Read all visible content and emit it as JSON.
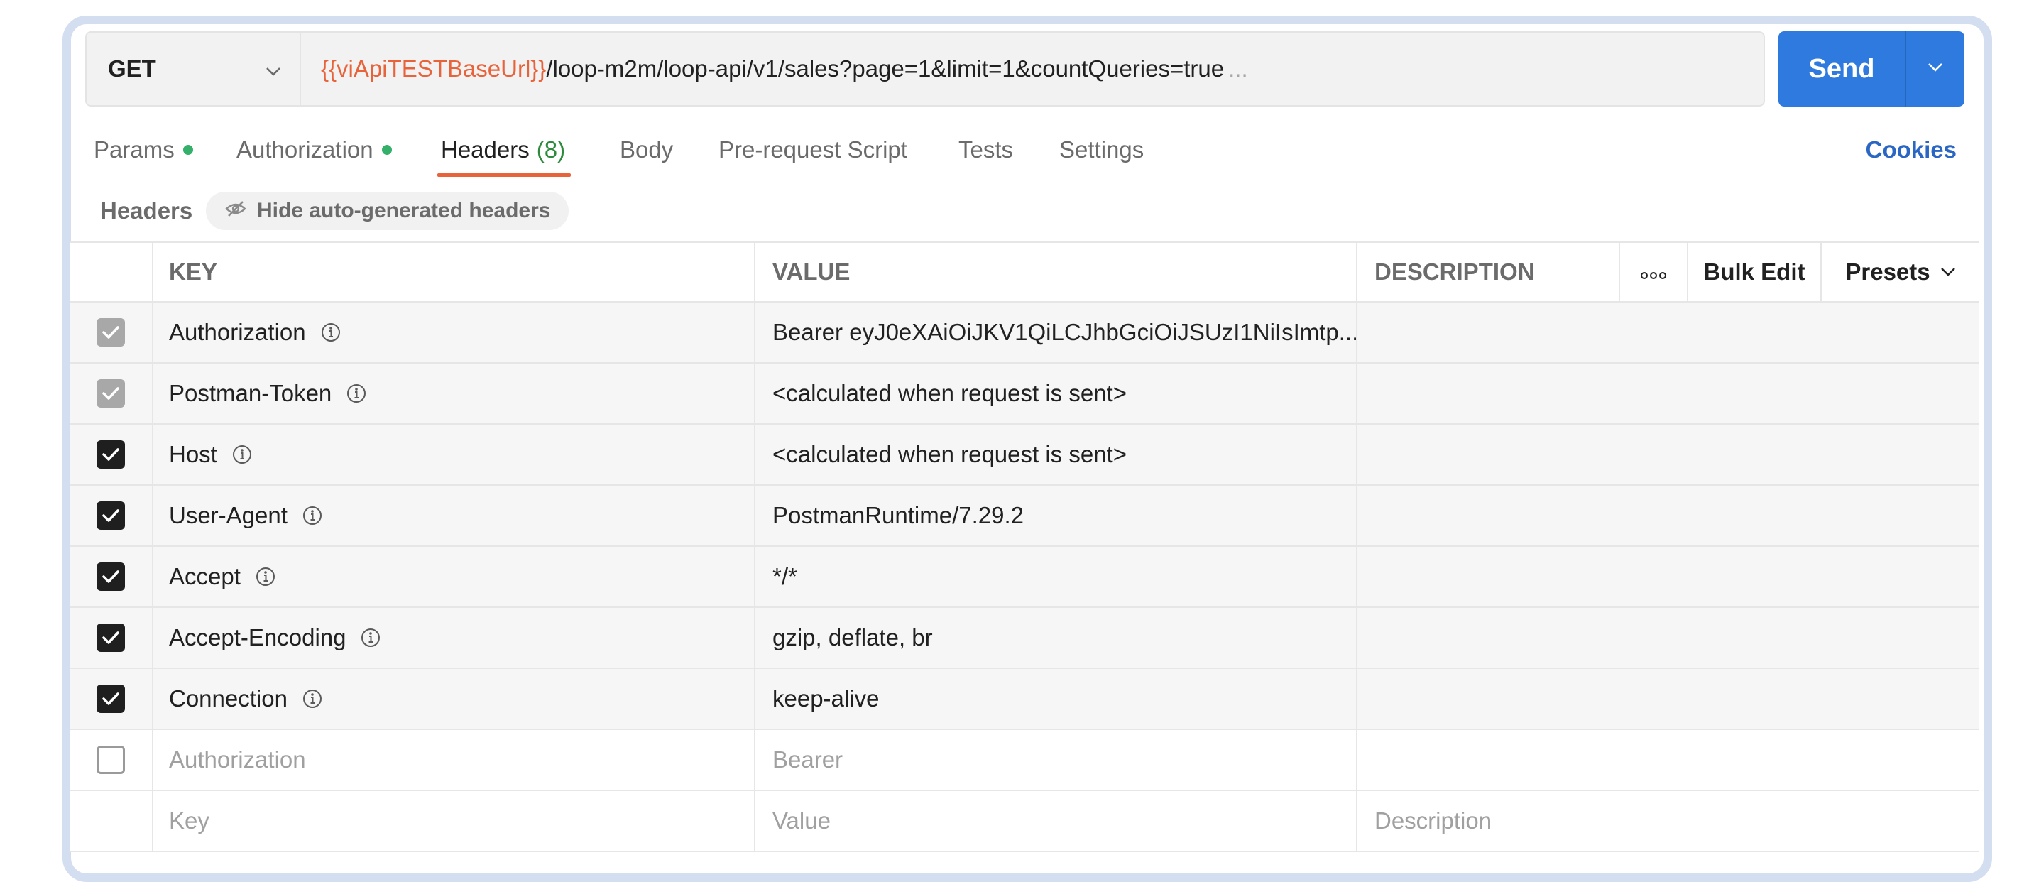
{
  "request": {
    "method": "GET",
    "url_variable": "{{viApiTESTBaseUrl}}",
    "url_path": "/loop-m2m/loop-api/v1/sales?page=1&limit=1&countQueries=true",
    "url_ellipsis": "...",
    "send_label": "Send"
  },
  "tabs": {
    "params": "Params",
    "authorization": "Authorization",
    "headers": "Headers",
    "headers_count": "(8)",
    "body": "Body",
    "pre_request": "Pre-request Script",
    "tests": "Tests",
    "settings": "Settings",
    "cookies": "Cookies"
  },
  "headers_section": {
    "label": "Headers",
    "hide_auto_label": "Hide auto-generated headers"
  },
  "table": {
    "columns": {
      "key": "KEY",
      "value": "VALUE",
      "description": "DESCRIPTION",
      "bulk_edit": "Bulk Edit",
      "presets": "Presets"
    },
    "rows": [
      {
        "key": "Authorization",
        "value": "Bearer eyJ0eXAiOiJKV1QiLCJhbGciOiJSUzI1NiIsImtp...",
        "state": "auto"
      },
      {
        "key": "Postman-Token",
        "value": "<calculated when request is sent>",
        "state": "auto"
      },
      {
        "key": "Host",
        "value": "<calculated when request is sent>",
        "state": "checked"
      },
      {
        "key": "User-Agent",
        "value": "PostmanRuntime/7.29.2",
        "state": "checked"
      },
      {
        "key": "Accept",
        "value": "*/*",
        "state": "checked"
      },
      {
        "key": "Accept-Encoding",
        "value": "gzip, deflate, br",
        "state": "checked"
      },
      {
        "key": "Connection",
        "value": "keep-alive",
        "state": "checked"
      }
    ],
    "disabled_row": {
      "key": "Authorization",
      "value": "Bearer"
    },
    "new_row": {
      "key": "Key",
      "value": "Value",
      "description": "Description"
    }
  },
  "colors": {
    "accent": "#e8623a",
    "send": "#2f7ade",
    "status_dot": "#35b06a",
    "link": "#2a66c3"
  }
}
